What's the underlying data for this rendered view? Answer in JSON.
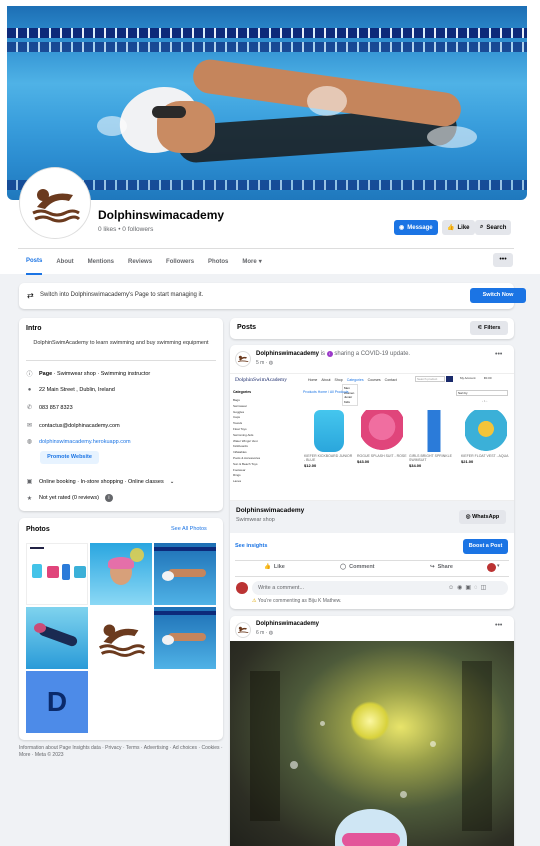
{
  "page": {
    "name": "Dolphinswimacademy",
    "stats": "0 likes • 0 followers"
  },
  "header_buttons": {
    "message": "Message",
    "like": "Like",
    "search": "Search"
  },
  "tabs": [
    "Posts",
    "About",
    "Mentions",
    "Reviews",
    "Followers",
    "Photos",
    "More"
  ],
  "switch_banner": {
    "text": "Switch into Dolphinswimacademy's Page to start managing it.",
    "button": "Switch Now"
  },
  "intro": {
    "title": "Intro",
    "bio": "DolphinSwimAcademy to learn swimming and buy swimming equipment",
    "category_bold": "Page",
    "category_rest": " · Swimwear shop · Swimming instructor",
    "address": "22 Main Street , Dublin, Ireland",
    "phone": "083 857 8323",
    "email": "contactus@dolphinacademy.com",
    "website": "dolphinswimacademy.herokuapp.com",
    "promote": "Promote Website",
    "services": "Online booking · In-store shopping · Online classes",
    "rating": "Not yet rated (0 reviews)"
  },
  "photos": {
    "title": "Photos",
    "see_all": "See All Photos",
    "letter": "D"
  },
  "footer": "Information about Page Insights data · Privacy · Terms · Advertising · Ad choices · Cookies · More · Meta © 2023",
  "posts_header": {
    "title": "Posts",
    "filters": "Filters"
  },
  "post1": {
    "author": "Dolphinswimacademy",
    "verb_a": " is ",
    "verb_b": " sharing a COVID-19 update.",
    "time": "5 m · ",
    "shop_logo": "DolphinSwimAcademy",
    "shop_nav": [
      "Home",
      "About",
      "Shop",
      "Categories",
      "Courses",
      "Contact"
    ],
    "shop_search_placeholder": "Search product",
    "shop_account": "My Account",
    "shop_bag": "€0.00",
    "shop_breadcrumb": "Products Home / All Products",
    "shop_sort": "Sort by",
    "shop_categories_title": "Categories",
    "shop_categories": [
      "Bags",
      "Swimwear",
      "Goggles",
      "Caps",
      "Towels",
      "Float Toys",
      "Swimming Aids",
      "Water Wings/ Vest",
      "Kickboards",
      "Inflatables",
      "Pools & Accessories",
      "Sun & Beach Toys",
      "Footwear",
      "Rings",
      "Lanes"
    ],
    "dropdown": [
      "Men",
      "Women",
      "Junior",
      "Kids"
    ],
    "products": [
      {
        "name": "KIEFER KICKBOARD JUNIOR - BLUE",
        "price": "$12.00"
      },
      {
        "name": "ROGUE SPLASH SUIT - ROSE",
        "price": "$43.00"
      },
      {
        "name": "GIRLS BRIGHT SPRINKLE SWIMSUIT",
        "price": "$34.00"
      },
      {
        "name": "KIEFER FLOAT VEST - AQUA",
        "price": "$21.00"
      }
    ],
    "pagination": "1",
    "link_title": "Dolphinswimacademy",
    "link_sub": "Swimwear shop",
    "whatsapp": "WhatsApp",
    "see_insights": "See insights",
    "boost": "Boost a Post",
    "like": "Like",
    "comment": "Comment",
    "share": "Share",
    "comment_placeholder": "Write a comment...",
    "commenting_as": "You're commenting as Biju K Mathew."
  },
  "post2": {
    "author": "Dolphinswimacademy",
    "time": "6 m · "
  },
  "colors": {
    "accent": "#1b74e4",
    "logo_brown": "#6b3a1e"
  }
}
